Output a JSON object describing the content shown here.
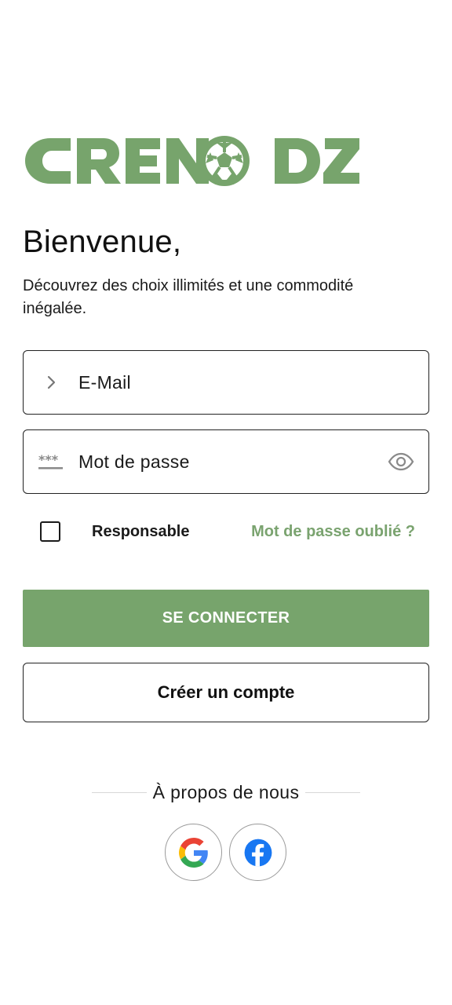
{
  "brand": {
    "logo_text": "CRENO DZ",
    "color": "#77a46c"
  },
  "welcome": {
    "title": "Bienvenue,",
    "subtitle": "Découvrez des choix illimités et une commodité inégalée."
  },
  "form": {
    "email": {
      "label": "E-Mail",
      "icon": "chevron-right-icon"
    },
    "password": {
      "label": "Mot de passe",
      "icon": "password-mask-icon",
      "toggle_icon": "eye-icon"
    },
    "remember": {
      "label": "Responsable",
      "checked": false
    },
    "forgot_label": "Mot de passe oublié ?",
    "login_label": "SE CONNECTER",
    "register_label": "Créer un compte"
  },
  "footer": {
    "about_label": "À propos de nous",
    "social": [
      {
        "name": "google",
        "icon": "google-icon"
      },
      {
        "name": "facebook",
        "icon": "facebook-icon"
      }
    ]
  },
  "colors": {
    "accent": "#77a46c",
    "text": "#111111",
    "border": "#222222"
  }
}
